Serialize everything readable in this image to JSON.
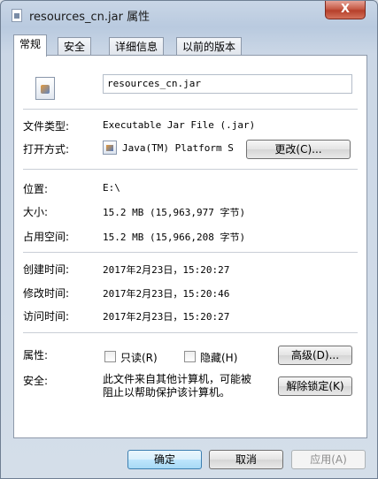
{
  "window": {
    "title": "resources_cn.jar 属性",
    "close_label": "X"
  },
  "tabs": [
    {
      "label": "常规",
      "active": true
    },
    {
      "label": "安全",
      "active": false
    },
    {
      "label": "详细信息",
      "active": false
    },
    {
      "label": "以前的版本",
      "active": false
    }
  ],
  "general": {
    "file_name": "resources_cn.jar",
    "file_type_label": "文件类型:",
    "file_type_value": "Executable Jar File (.jar)",
    "opens_with_label": "打开方式:",
    "opens_with_value": "Java(TM) Platform S",
    "change_button": "更改(C)...",
    "location_label": "位置:",
    "location_value": "E:\\",
    "size_label": "大小:",
    "size_value": "15.2 MB (15,963,977 字节)",
    "size_on_disk_label": "占用空间:",
    "size_on_disk_value": "15.2 MB (15,966,208 字节)",
    "created_label": "创建时间:",
    "created_value": "2017年2月23日，15:20:27",
    "modified_label": "修改时间:",
    "modified_value": "2017年2月23日，15:20:46",
    "accessed_label": "访问时间:",
    "accessed_value": "2017年2月23日，15:20:27",
    "attributes_label": "属性:",
    "readonly_label": "只读(R)",
    "hidden_label": "隐藏(H)",
    "advanced_button": "高级(D)...",
    "security_label": "安全:",
    "security_text": "此文件来自其他计算机，可能被阻止以帮助保护该计算机。",
    "unblock_button": "解除锁定(K)"
  },
  "footer": {
    "ok_button": "确定",
    "cancel_button": "取消",
    "apply_button": "应用(A)"
  },
  "colors": {
    "accent": "#3c7fb1",
    "close": "#c75c48"
  }
}
